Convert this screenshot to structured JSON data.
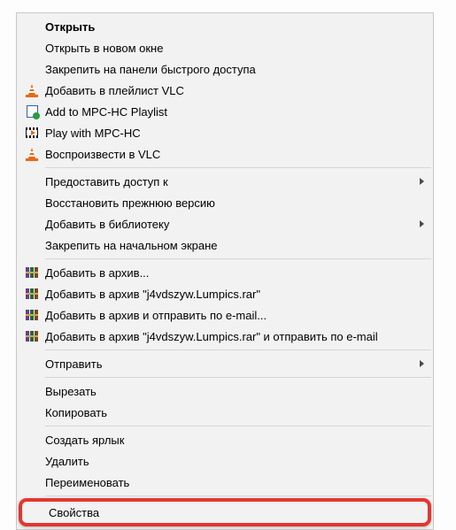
{
  "menu": {
    "open": "Открыть",
    "openNewWindow": "Открыть в новом окне",
    "pinQuickAccess": "Закрепить на панели быстрого доступа",
    "addVlcPlaylist": "Добавить в плейлист VLC",
    "addMpcPlaylist": "Add to MPC-HC Playlist",
    "playMpc": "Play with MPC-HC",
    "playVlc": "Воспроизвести в VLC",
    "grantAccess": "Предоставить доступ к",
    "restorePrev": "Восстановить прежнюю версию",
    "addLibrary": "Добавить в библиотеку",
    "pinStart": "Закрепить на начальном экране",
    "rarAdd": "Добавить в архив...",
    "rarAddNamed": "Добавить в архив \"j4vdszyw.Lumpics.rar\"",
    "rarEmail": "Добавить в архив и отправить по e-mail...",
    "rarEmailNamed": "Добавить в архив \"j4vdszyw.Lumpics.rar\" и отправить по e-mail",
    "send": "Отправить",
    "cut": "Вырезать",
    "copy": "Копировать",
    "createShortcut": "Создать ярлык",
    "delete": "Удалить",
    "rename": "Переименовать",
    "properties": "Свойства"
  }
}
